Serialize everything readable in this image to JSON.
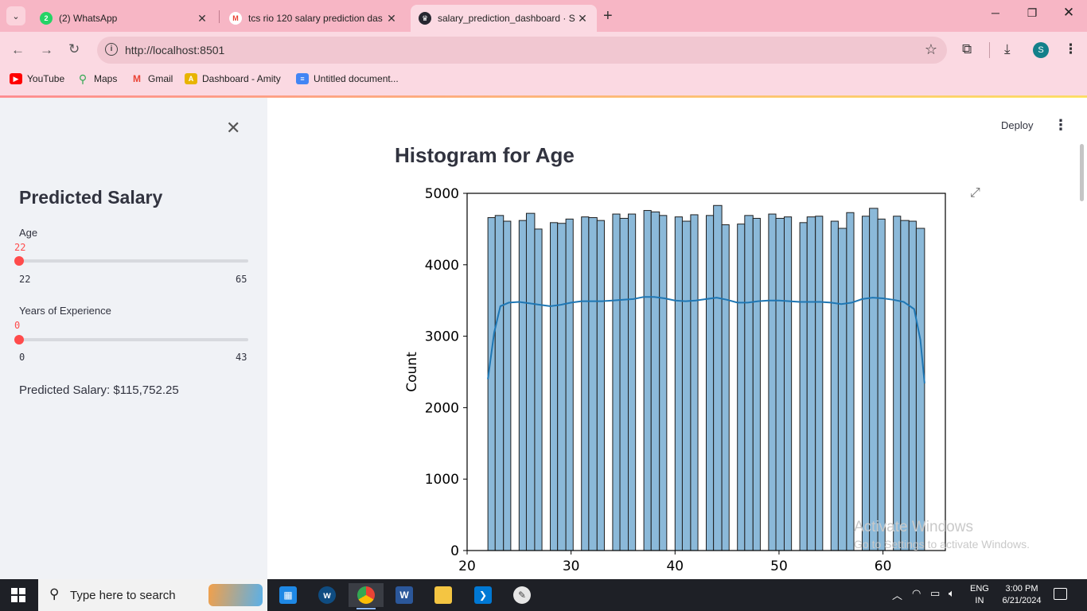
{
  "browser": {
    "tabs": [
      {
        "title": "(2) WhatsApp",
        "favicon": "whatsapp-icon",
        "badge": "2",
        "color": "#25d366",
        "active": false
      },
      {
        "title": "tcs rio 120 salary prediction das",
        "favicon": "gmail-icon",
        "badge": "M",
        "color": "#ea4335",
        "active": false
      },
      {
        "title": "salary_prediction_dashboard · S",
        "favicon": "streamlit-icon",
        "badge": "",
        "color": "#262730",
        "active": true
      }
    ],
    "new_tab": "+",
    "url": "http://localhost:8501",
    "bookmarks": [
      {
        "label": "YouTube",
        "icon": "youtube-icon",
        "color": "#ff0000"
      },
      {
        "label": "Maps",
        "icon": "maps-icon",
        "color": "#34a853"
      },
      {
        "label": "Gmail",
        "icon": "gmail-icon",
        "color": "#ea4335"
      },
      {
        "label": "Dashboard - Amity",
        "icon": "amity-icon",
        "color": "#e8b400"
      },
      {
        "label": "Untitled document...",
        "icon": "docs-icon",
        "color": "#4285f4"
      }
    ],
    "profile_initial": "S"
  },
  "sidebar": {
    "title": "Predicted Salary",
    "age_slider": {
      "label": "Age",
      "value": "22",
      "min": "22",
      "max": "65",
      "fraction": 0.0
    },
    "experience_slider": {
      "label": "Years of Experience",
      "value": "0",
      "min": "0",
      "max": "43",
      "fraction": 0.0
    },
    "prediction": "Predicted Salary: $115,752.25"
  },
  "main": {
    "deploy_label": "Deploy",
    "chart_title": "Histogram for Age"
  },
  "chart_data": {
    "type": "bar",
    "title": "",
    "xlabel": "",
    "ylabel": "Count",
    "xlim": [
      20,
      66
    ],
    "ylim": [
      0,
      5000
    ],
    "xticks": [
      "20",
      "30",
      "40",
      "50",
      "60"
    ],
    "yticks": [
      "0",
      "1000",
      "2000",
      "3000",
      "4000",
      "5000"
    ],
    "bar_color": "#8bb9d9",
    "bar_edge": "#1f1f1f",
    "bins": [
      {
        "x0": 22.0,
        "x1": 22.7,
        "count": 4660
      },
      {
        "x0": 22.7,
        "x1": 23.5,
        "count": 4690
      },
      {
        "x0": 23.5,
        "x1": 24.2,
        "count": 4610
      },
      {
        "x0": 25.0,
        "x1": 25.7,
        "count": 4620
      },
      {
        "x0": 25.7,
        "x1": 26.5,
        "count": 4720
      },
      {
        "x0": 26.5,
        "x1": 27.2,
        "count": 4500
      },
      {
        "x0": 28.0,
        "x1": 28.7,
        "count": 4590
      },
      {
        "x0": 28.7,
        "x1": 29.5,
        "count": 4580
      },
      {
        "x0": 29.5,
        "x1": 30.2,
        "count": 4640
      },
      {
        "x0": 31.0,
        "x1": 31.7,
        "count": 4670
      },
      {
        "x0": 31.7,
        "x1": 32.5,
        "count": 4660
      },
      {
        "x0": 32.5,
        "x1": 33.2,
        "count": 4620
      },
      {
        "x0": 34.0,
        "x1": 34.7,
        "count": 4710
      },
      {
        "x0": 34.7,
        "x1": 35.5,
        "count": 4650
      },
      {
        "x0": 35.5,
        "x1": 36.2,
        "count": 4710
      },
      {
        "x0": 37.0,
        "x1": 37.7,
        "count": 4760
      },
      {
        "x0": 37.7,
        "x1": 38.5,
        "count": 4740
      },
      {
        "x0": 38.5,
        "x1": 39.2,
        "count": 4690
      },
      {
        "x0": 40.0,
        "x1": 40.7,
        "count": 4670
      },
      {
        "x0": 40.7,
        "x1": 41.5,
        "count": 4610
      },
      {
        "x0": 41.5,
        "x1": 42.2,
        "count": 4700
      },
      {
        "x0": 43.0,
        "x1": 43.7,
        "count": 4690
      },
      {
        "x0": 43.7,
        "x1": 44.5,
        "count": 4830
      },
      {
        "x0": 44.5,
        "x1": 45.2,
        "count": 4560
      },
      {
        "x0": 46.0,
        "x1": 46.7,
        "count": 4570
      },
      {
        "x0": 46.7,
        "x1": 47.5,
        "count": 4690
      },
      {
        "x0": 47.5,
        "x1": 48.2,
        "count": 4650
      },
      {
        "x0": 49.0,
        "x1": 49.7,
        "count": 4710
      },
      {
        "x0": 49.7,
        "x1": 50.5,
        "count": 4650
      },
      {
        "x0": 50.5,
        "x1": 51.2,
        "count": 4670
      },
      {
        "x0": 52.0,
        "x1": 52.7,
        "count": 4590
      },
      {
        "x0": 52.7,
        "x1": 53.5,
        "count": 4670
      },
      {
        "x0": 53.5,
        "x1": 54.2,
        "count": 4680
      },
      {
        "x0": 55.0,
        "x1": 55.7,
        "count": 4610
      },
      {
        "x0": 55.7,
        "x1": 56.5,
        "count": 4510
      },
      {
        "x0": 56.5,
        "x1": 57.2,
        "count": 4730
      },
      {
        "x0": 58.0,
        "x1": 58.7,
        "count": 4680
      },
      {
        "x0": 58.7,
        "x1": 59.5,
        "count": 4790
      },
      {
        "x0": 59.5,
        "x1": 60.2,
        "count": 4640
      },
      {
        "x0": 61.0,
        "x1": 61.7,
        "count": 4680
      },
      {
        "x0": 61.7,
        "x1": 62.5,
        "count": 4620
      },
      {
        "x0": 62.5,
        "x1": 63.2,
        "count": 4610
      },
      {
        "x0": 63.2,
        "x1": 64.0,
        "count": 4510
      }
    ],
    "kde": {
      "color": "#1f77b4",
      "points": [
        [
          22.0,
          2400
        ],
        [
          22.6,
          3050
        ],
        [
          23.2,
          3420
        ],
        [
          24.0,
          3470
        ],
        [
          25.0,
          3480
        ],
        [
          26.0,
          3460
        ],
        [
          27.0,
          3440
        ],
        [
          28.0,
          3420
        ],
        [
          29.0,
          3440
        ],
        [
          30.0,
          3470
        ],
        [
          31.0,
          3490
        ],
        [
          32.0,
          3490
        ],
        [
          33.0,
          3490
        ],
        [
          34.0,
          3500
        ],
        [
          35.0,
          3510
        ],
        [
          36.0,
          3520
        ],
        [
          37.0,
          3550
        ],
        [
          38.0,
          3550
        ],
        [
          39.0,
          3530
        ],
        [
          40.0,
          3500
        ],
        [
          41.0,
          3490
        ],
        [
          42.0,
          3500
        ],
        [
          43.0,
          3520
        ],
        [
          44.0,
          3540
        ],
        [
          45.0,
          3510
        ],
        [
          46.0,
          3470
        ],
        [
          47.0,
          3470
        ],
        [
          48.0,
          3490
        ],
        [
          49.0,
          3500
        ],
        [
          50.0,
          3500
        ],
        [
          51.0,
          3490
        ],
        [
          52.0,
          3480
        ],
        [
          53.0,
          3480
        ],
        [
          54.0,
          3480
        ],
        [
          55.0,
          3470
        ],
        [
          56.0,
          3450
        ],
        [
          57.0,
          3470
        ],
        [
          58.0,
          3520
        ],
        [
          59.0,
          3540
        ],
        [
          60.0,
          3530
        ],
        [
          61.0,
          3510
        ],
        [
          62.0,
          3480
        ],
        [
          63.0,
          3380
        ],
        [
          63.6,
          2950
        ],
        [
          64.0,
          2340
        ]
      ]
    }
  },
  "watermark": {
    "line1": "Activate Windows",
    "line2": "Go to Settings to activate Windows."
  },
  "taskbar": {
    "search_placeholder": "Type here to search",
    "language": "ENG",
    "region": "IN",
    "time": "3:00 PM",
    "date": "6/21/2024"
  }
}
